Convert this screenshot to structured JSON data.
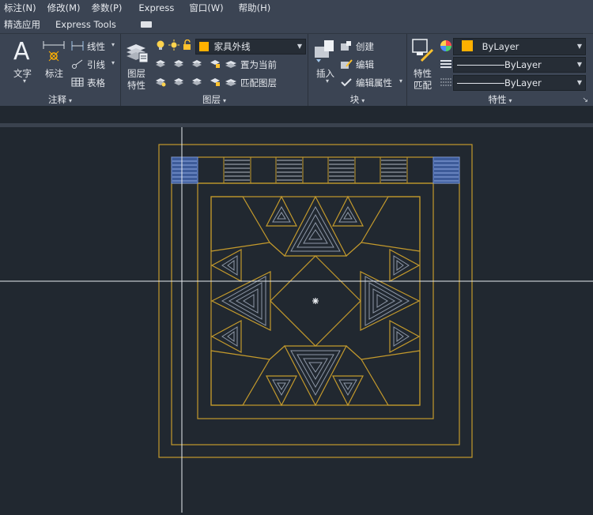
{
  "menu": {
    "items": [
      "标注(N)",
      "修改(M)",
      "参数(P)",
      "Express",
      "窗口(W)",
      "帮助(H)"
    ]
  },
  "tabs": {
    "items": [
      "精选应用",
      "Express Tools"
    ]
  },
  "ribbon": {
    "annotation": {
      "text_label": "文字",
      "dim_label": "标注",
      "linear_label": "线性",
      "leader_label": "引线",
      "table_label": "表格",
      "title": "注释"
    },
    "layers": {
      "props_label_1": "图层",
      "props_label_2": "特性",
      "current_layer": "家具外线",
      "set_current_label": "置为当前",
      "match_layer_label": "匹配图层",
      "title": "图层"
    },
    "block": {
      "insert_label": "插入",
      "create_label": "创建",
      "edit_label": "编辑",
      "edit_attr_label": "编辑属性",
      "title": "块"
    },
    "properties": {
      "match_label_1": "特性",
      "match_label_2": "匹配",
      "color_value": "ByLayer",
      "linetype_value": "ByLayer",
      "lineweight_value": "ByLayer",
      "title": "特性"
    }
  },
  "colors": {
    "accent_yellow": "#ffb000",
    "drawing_line": "#c49a2c",
    "inner_line": "#8e98a8",
    "selection_blue": "#4c6fb8"
  }
}
